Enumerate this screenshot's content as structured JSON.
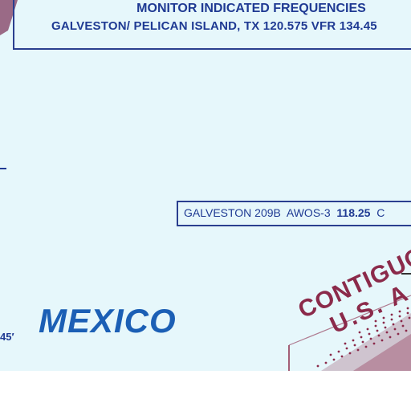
{
  "notice": {
    "line1": "MONITOR INDICATED FREQUENCIES",
    "line2": "GALVESTON/ PELICAN ISLAND, TX 120.575 VFR 134.45"
  },
  "awos": {
    "station": "GALVESTON 209B",
    "type": "AWOS-3",
    "frequency": "118.25",
    "trailing": "C"
  },
  "country_label": "MEXICO",
  "coordinate_label": "45′",
  "stamp": {
    "line1": "CONTIGUOUS",
    "line2": "U.S. A"
  },
  "colors": {
    "water": "#e6f7fb",
    "label_blue": "#1f3a93",
    "country_blue": "#1b5fb5",
    "stamp_maroon": "#8b2a4a",
    "land_mauve": "#9a6a86"
  }
}
